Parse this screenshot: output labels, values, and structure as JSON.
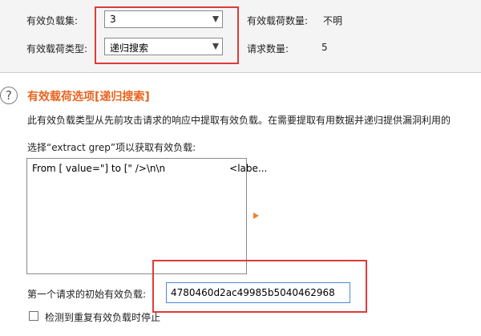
{
  "payload_set": {
    "label": "有效负载集:",
    "value": "3"
  },
  "payload_type": {
    "label": "有效载荷类型:",
    "value": "递归搜索"
  },
  "payload_count": {
    "label": "有效载荷数量:",
    "value": "不明"
  },
  "request_count": {
    "label": "请求数量:",
    "value": "5"
  },
  "section": {
    "title": "有效载荷选项[递归搜索]",
    "description": "此有效负载类型从先前攻击请求的响应中提取有效负载。在需要提取有用数据并递归提供漏洞利用的",
    "instruction": "选择“extract grep”项以获取有效负载:",
    "grep_items": [
      {
        "text": "From [ value=\"] to [\" />\\n\\n",
        "tag": "<labe..."
      }
    ]
  },
  "initial_payload": {
    "label": "第一个请求的初始有效负载:",
    "value": "4780460d2ac49985b5040462968"
  },
  "stop_duplicate": {
    "label": "检测到重复有效负载时停止",
    "checked": false
  },
  "colors": {
    "accent": "#e8641f",
    "highlight_border": "#e03a3a",
    "input_focus": "#4a8ad8"
  }
}
